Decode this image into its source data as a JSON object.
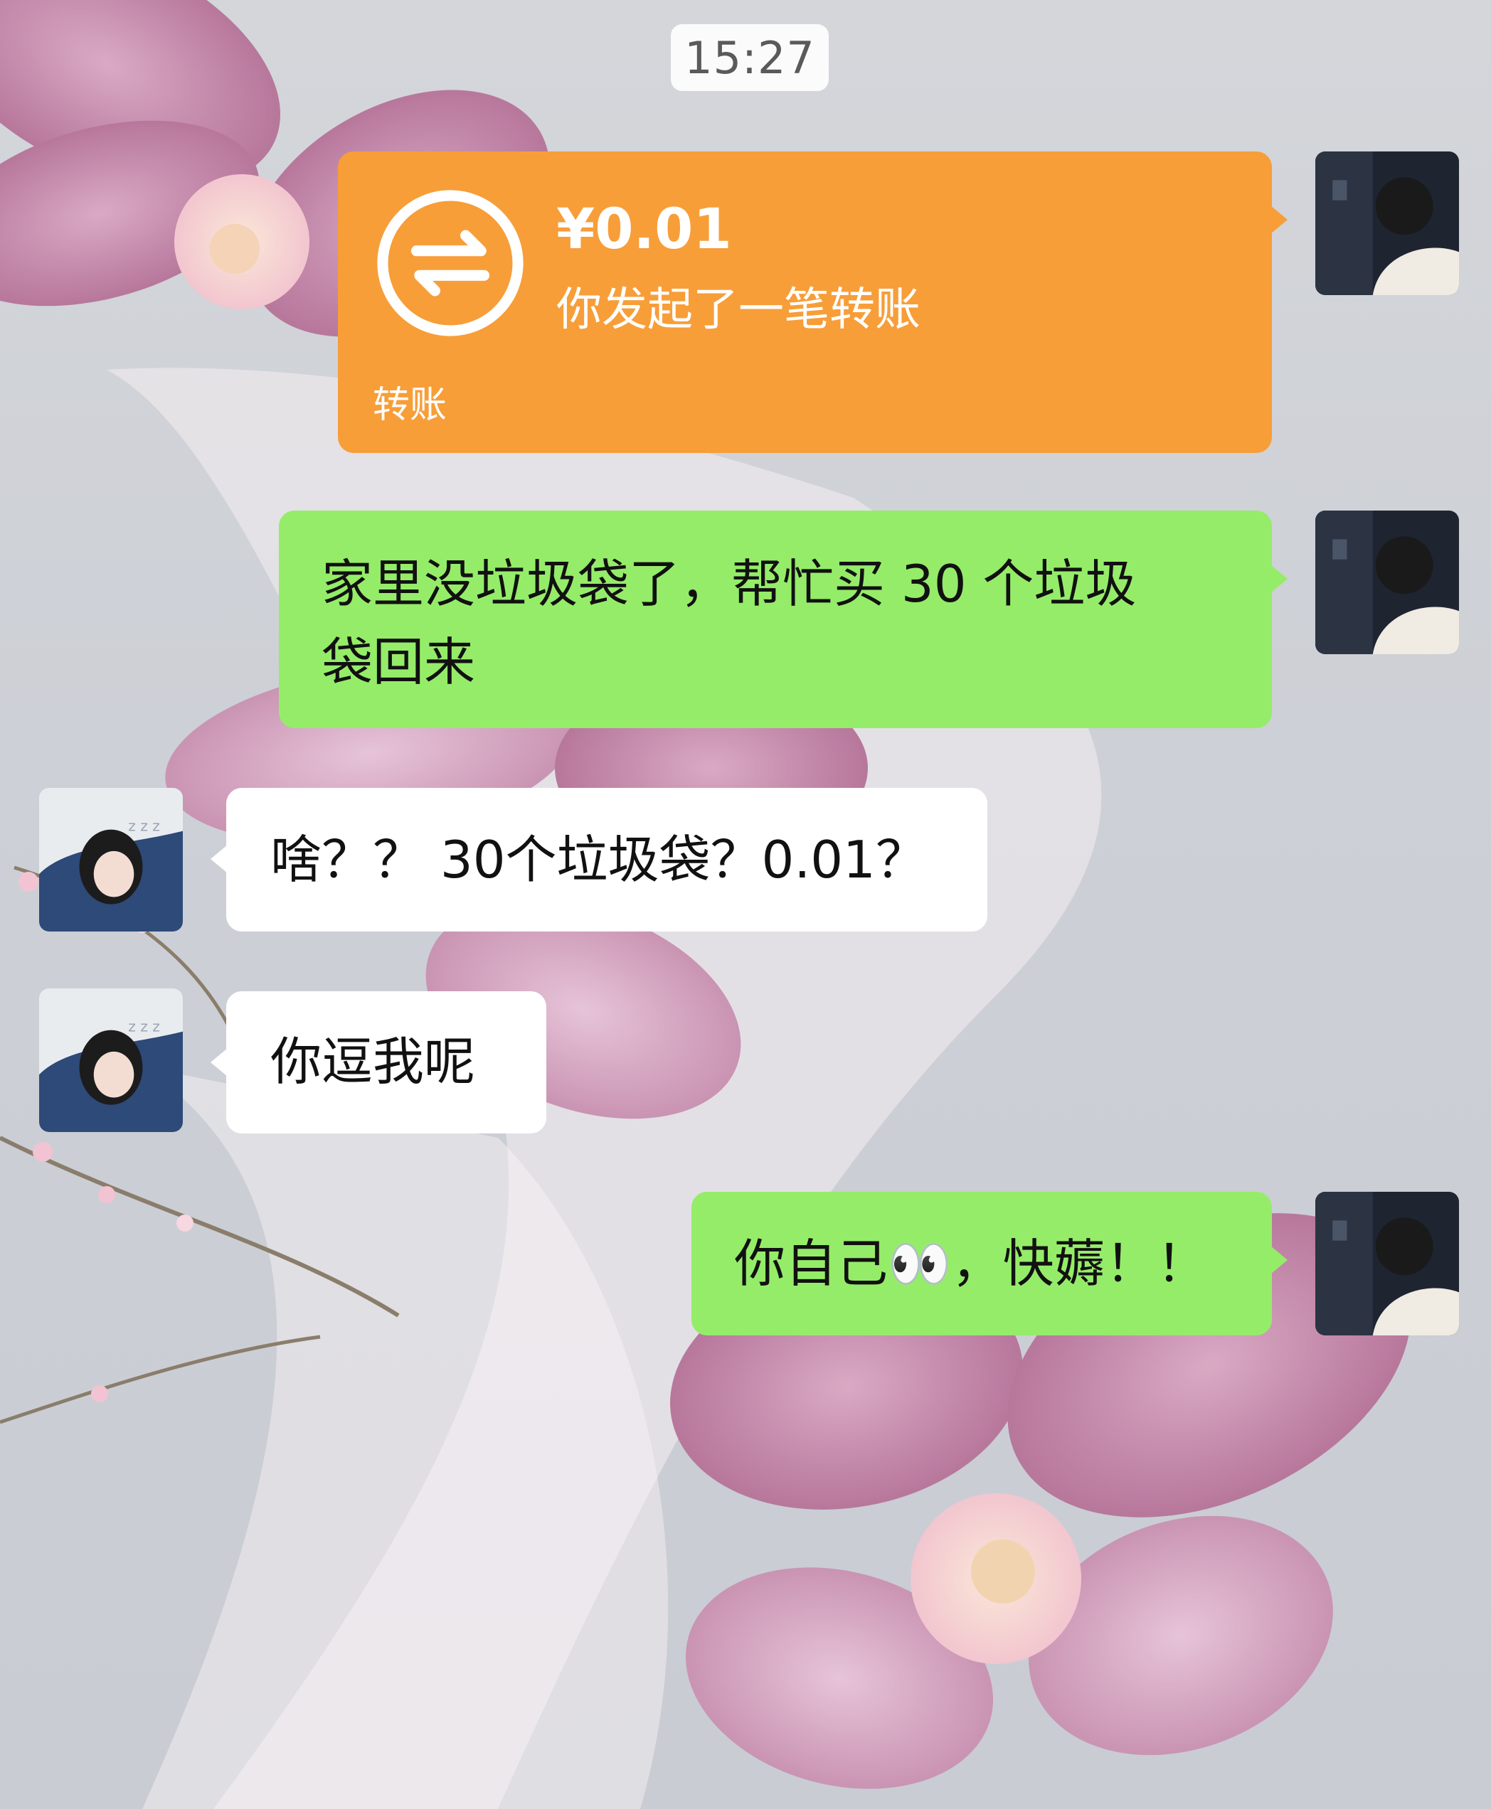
{
  "status": {
    "time": "15:27"
  },
  "messages": [
    {
      "side": "right",
      "type": "transfer",
      "amount": "¥0.01",
      "subtitle": "你发起了一笔转账",
      "label": "转账",
      "icon": "transfer-arrows-icon",
      "color": "#f79e39"
    },
    {
      "side": "right",
      "type": "text",
      "line1": "家里没垃圾袋了，帮忙买 30 个垃圾",
      "line2": "袋回来",
      "color": "#95ec69"
    },
    {
      "side": "left",
      "type": "text",
      "text": "啥？？ 30个垃圾袋？0.01？",
      "color": "#ffffff"
    },
    {
      "side": "left",
      "type": "text",
      "text": "你逗我呢",
      "color": "#ffffff"
    },
    {
      "side": "right",
      "type": "text",
      "text_before": "你自己",
      "emoji": "👀",
      "text_after": "，快薅！！",
      "color": "#95ec69"
    }
  ],
  "avatars": {
    "self": "avatar-boy-dark-room",
    "other": "avatar-girl-sleeping"
  }
}
